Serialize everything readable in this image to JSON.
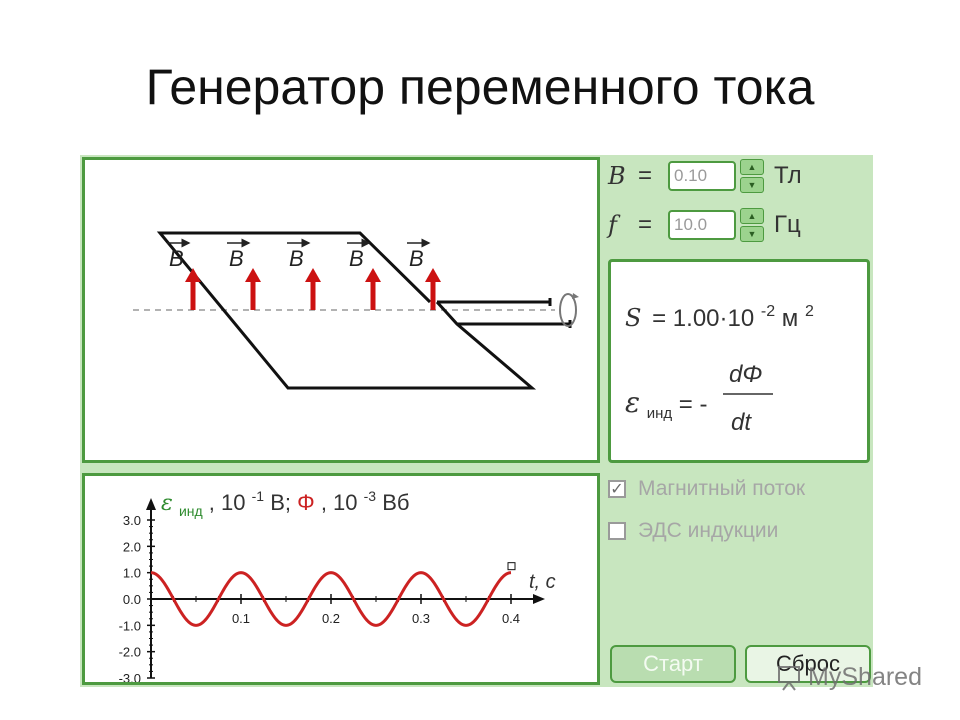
{
  "slide": {
    "title": "Генератор переменного тока"
  },
  "controls": {
    "B": {
      "symbol": "B",
      "eq": "=",
      "value": "0.10",
      "unit": "Тл"
    },
    "f": {
      "symbol": "f",
      "eq": "=",
      "value": "10.0",
      "unit": "Гц"
    }
  },
  "formula": {
    "S_symbol": "S",
    "S_eq": "= 1.00·10",
    "S_exp": "-2",
    "S_unit": " м",
    "S_unit_exp": "2",
    "emf_symbol": "ε",
    "emf_sub": "инд",
    "emf_eq": "= -",
    "numerator": "dΦ",
    "denominator": "dt"
  },
  "scene": {
    "field_label": "B"
  },
  "checkboxes": [
    {
      "label": "Магнитный поток",
      "checked": true
    },
    {
      "label": "ЭДС индукции",
      "checked": false
    }
  ],
  "buttons": {
    "start": "Старт",
    "reset": "Сброс"
  },
  "watermark": {
    "text": "MyShared"
  },
  "chart_data": {
    "type": "line",
    "title_parts": {
      "emf_symbol": "ε",
      "emf_sub": "инд",
      "emf_scale": ", 10",
      "emf_exp": "-1",
      "emf_unit": "В;",
      "flux_symbol": "Φ",
      "flux_scale": ", 10",
      "flux_exp": "-3",
      "flux_unit": "Вб"
    },
    "xlabel": "t, с",
    "x_ticks": [
      "0.1",
      "0.2",
      "0.3",
      "0.4"
    ],
    "y_ticks": [
      "3.0",
      "2.0",
      "1.0",
      "0.0",
      "-1.0",
      "-2.0",
      "-3.0"
    ],
    "xlim": [
      0,
      0.4
    ],
    "ylim": [
      -3,
      3
    ],
    "series": [
      {
        "name": "Φ",
        "amplitude": 1.0,
        "frequency": 10,
        "phase": "cos",
        "color": "#cc2222"
      }
    ]
  },
  "colors": {
    "panel_border": "#4d9a40",
    "sim_bg": "#c8e6bf",
    "arrow": "#cc1111",
    "flux_curve": "#cc2222",
    "emf_text": "#2e8b2e"
  }
}
